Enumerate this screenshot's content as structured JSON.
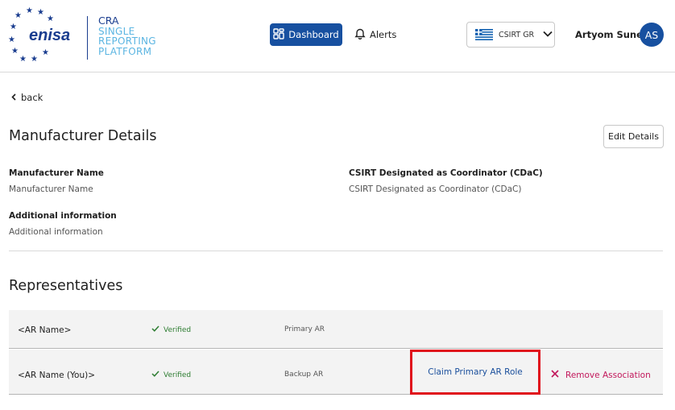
{
  "header": {
    "logo_text": "enisa",
    "cra_title": "CRA",
    "cra_subtitle_lines": [
      "SINGLE",
      "REPORTING",
      "PLATFORM"
    ],
    "nav": {
      "dashboard_label": "Dashboard",
      "alerts_label": "Alerts"
    },
    "csirt_select": {
      "value": "CSIRT GR",
      "flag_icon": "greece-flag-icon"
    },
    "user": {
      "name": "Artyom Sunek",
      "initials": "AS"
    }
  },
  "main": {
    "back_label": "back",
    "title": "Manufacturer Details",
    "edit_button_label": "Edit Details",
    "fields": {
      "manufacturer_name_label": "Manufacturer Name",
      "manufacturer_name_value": "Manufacturer Name",
      "csirt_label": "CSIRT Designated as Coordinator (CDaC)",
      "csirt_value": "CSIRT Designated as Coordinator (CDaC)",
      "additional_label": "Additional information",
      "additional_value": "Additional information"
    },
    "representatives": {
      "title": "Representatives",
      "rows": [
        {
          "name": "<AR Name>",
          "status": "Verified",
          "role": "Primary AR"
        },
        {
          "name": "<AR Name (You)>",
          "status": "Verified",
          "role": "Backup AR",
          "claim_label": "Claim Primary AR Role",
          "remove_label": "Remove Association"
        }
      ]
    }
  },
  "colors": {
    "primary": "#1750a0",
    "verified": "#2e7d32",
    "remove": "#c2185b",
    "highlight": "#e0101c",
    "brand_light": "#5bb5e2"
  }
}
